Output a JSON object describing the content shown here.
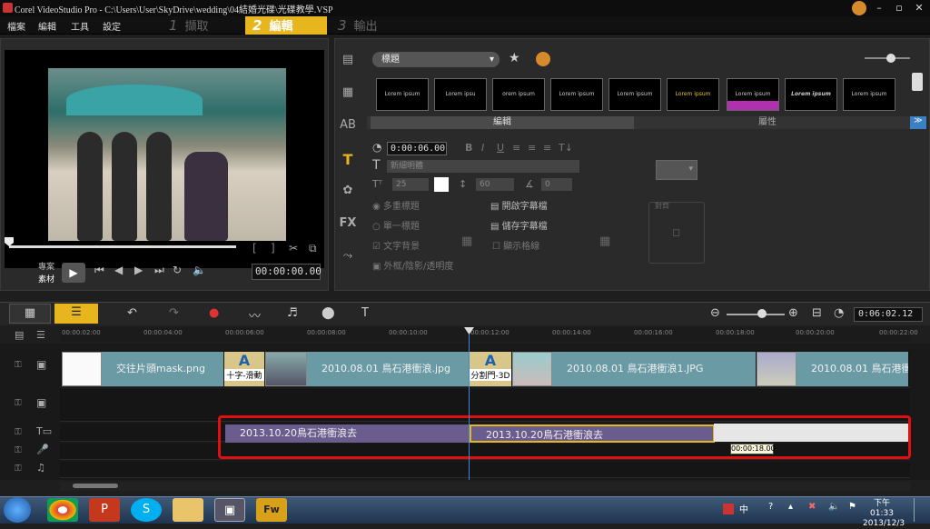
{
  "window": {
    "title": "Corel VideoStudio Pro - C:\\Users\\User\\SkyDrive\\wedding\\04結婚光碟\\光碟教學.VSP",
    "minimize": "–",
    "maximize": "▫",
    "close": "✕"
  },
  "menu": {
    "items": [
      "檔案",
      "編輯",
      "工具",
      "設定"
    ],
    "steps": [
      {
        "num": "1",
        "label": "擷取"
      },
      {
        "num": "2",
        "label": "編輯"
      },
      {
        "num": "3",
        "label": "輸出"
      }
    ]
  },
  "preview": {
    "mode_project": "專案",
    "mode_clip": "素材",
    "timecode": "00:00:00.00",
    "bracket_in": "[",
    "bracket_out": "]"
  },
  "library": {
    "category": "標題",
    "thumbnails": [
      "Lorem ipsum",
      "Lorem ipsu",
      "orem ipsum",
      "Lorem ipsum",
      "Lorem ipsum",
      "Lorem ipsum",
      "Lorem ipsum",
      "Lorem ipsum",
      "Lorem ipsum"
    ],
    "tab_edit": "編輯",
    "tab_attr": "屬性"
  },
  "options": {
    "duration": "0:00:06.00",
    "format_buttons": [
      "B",
      "I",
      "U",
      "≡",
      "≡",
      "≡",
      "T↓"
    ],
    "font": "新細明體",
    "font_size": "25",
    "line_spacing": "60",
    "angle": "0",
    "multi_title": "多重標題",
    "single_title": "單一標題",
    "text_bg": "文字背景",
    "show_grid": "顯示格線",
    "open_subtitle": "開啟字幕檔",
    "save_subtitle": "儲存字幕檔",
    "border_shadow": "外框/陰影/透明度",
    "align_label": "對齊"
  },
  "timeline": {
    "timecode": "0:06:02.12",
    "ruler": [
      "00:00:02:00",
      "00:00:04:00",
      "00:00:06:00",
      "00:00:08:00",
      "00:00:10:00",
      "00:00:12:00",
      "00:00:14:00",
      "00:00:16:00",
      "00:00:18:00",
      "00:00:20:00",
      "00:00:22:00"
    ],
    "video_clips": [
      {
        "label": "交往片頭mask.png"
      },
      {
        "label": "2010.08.01 鳥石港衝浪.jpg"
      },
      {
        "label": "2010.08.01 鳥石港衝浪1.JPG"
      },
      {
        "label": "2010.08.01 鳥石港衝浪"
      }
    ],
    "transitions": [
      "十字-滑動",
      "分割門-3D"
    ],
    "transition_letters": [
      "A",
      "A"
    ],
    "title_clips": [
      {
        "label": "2013.10.20鳥石港衝浪去"
      },
      {
        "label": "2013.10.20鳥石港衝浪去"
      }
    ],
    "tooltip": "00:00:18.00"
  },
  "taskbar": {
    "time": "下午 01:33",
    "date": "2013/12/3",
    "ime": "中",
    "apps": [
      "chrome",
      "powerpoint",
      "skype",
      "explorer",
      "videostudio",
      "fireworks"
    ],
    "fw_label": "Fw"
  },
  "colors": {
    "accent": "#e7b51d",
    "clip": "#6a9aa4",
    "title_clip": "#6a5d8e",
    "highlight": "#e01010",
    "playhead": "#3a86d9"
  }
}
